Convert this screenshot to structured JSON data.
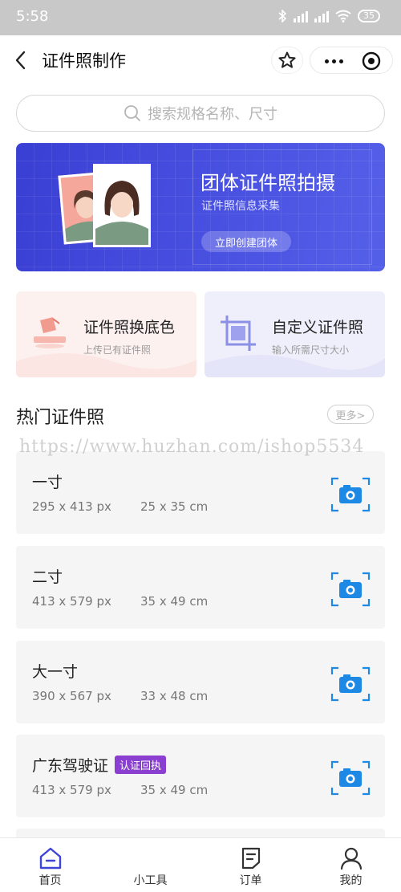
{
  "status_bar": {
    "time": "5:58",
    "battery": "35"
  },
  "nav": {
    "title": "证件照制作"
  },
  "search": {
    "placeholder": "搜索规格名称、尺寸"
  },
  "banner": {
    "title": "团体证件照拍摄",
    "subtitle": "证件照信息采集",
    "button": "立即创建团体"
  },
  "features": [
    {
      "title": "证件照换底色",
      "subtitle": "上传已有证件照"
    },
    {
      "title": "自定义证件照",
      "subtitle": "输入所需尺寸大小"
    }
  ],
  "section": {
    "title": "热门证件照",
    "more": "更多>"
  },
  "watermark": "https://www.huzhan.com/ishop5534",
  "items": [
    {
      "name": "一寸",
      "badge": "",
      "px": "295 x 413 px",
      "cm": "25 x 35 cm"
    },
    {
      "name": "二寸",
      "badge": "",
      "px": "413 x 579 px",
      "cm": "35 x 49 cm"
    },
    {
      "name": "大一寸",
      "badge": "",
      "px": "390 x 567 px",
      "cm": "33 x 48 cm"
    },
    {
      "name": "广东驾驶证",
      "badge": "认证回执",
      "px": "413 x 579 px",
      "cm": "35 x 49 cm"
    }
  ],
  "tabs": [
    {
      "label": "首页",
      "icon": "home-icon",
      "active": true
    },
    {
      "label": "小工具",
      "icon": "tools-icon",
      "active": false
    },
    {
      "label": "订单",
      "icon": "order-icon",
      "active": false
    },
    {
      "label": "我的",
      "icon": "user-icon",
      "active": false
    }
  ],
  "colors": {
    "accent": "#3d44d6",
    "camera": "#1e88e5",
    "badge": "#8a3fd0",
    "red_card": "#fdf1f0",
    "blue_card": "#efeffc"
  }
}
